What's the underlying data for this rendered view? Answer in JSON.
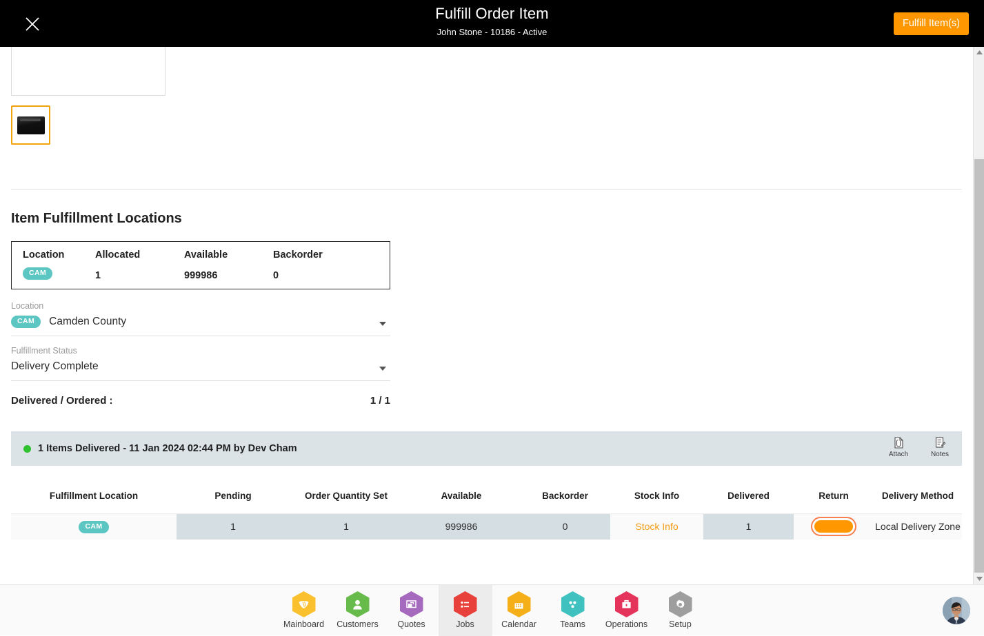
{
  "header": {
    "close_icon": "close-icon",
    "title": "Fulfill Order Item",
    "subtitle": "John Stone - 10186 - Active",
    "fulfill_button": "Fulfill Item(s)",
    "background": "#000000",
    "accent": "#ff9800"
  },
  "section": {
    "title": "Item Fulfillment Locations"
  },
  "location_card": {
    "headers": [
      "Location",
      "Allocated",
      "Available",
      "Backorder"
    ],
    "row": {
      "location_badge": "CAM",
      "allocated": "1",
      "available": "999986",
      "backorder": "0"
    }
  },
  "fields": {
    "location": {
      "label": "Location",
      "badge": "CAM",
      "value": "Camden County",
      "caret_icon": "chevron-down-icon"
    },
    "fulfillment_status": {
      "label": "Fulfillment Status",
      "value": "Delivery Complete",
      "caret_icon": "chevron-down-icon"
    }
  },
  "delivered_ordered": {
    "label": "Delivered / Ordered :",
    "value": "1 / 1"
  },
  "status_bar": {
    "dot_color": "#2fc22f",
    "text": "1 Items Delivered - 11 Jan 2024 02:44 PM by Dev Cham",
    "actions": [
      {
        "icon": "attach-icon",
        "label": "Attach"
      },
      {
        "icon": "notes-icon",
        "label": "Notes"
      }
    ]
  },
  "table": {
    "columns": [
      "Fulfillment Location",
      "Pending",
      "Order Quantity Set",
      "Available",
      "Backorder",
      "Stock Info",
      "Delivered",
      "Return",
      "Delivery Method"
    ],
    "rows": [
      {
        "fulfillment_location": "CAM",
        "pending": "1",
        "order_quantity_set": "1",
        "available": "999986",
        "backorder": "0",
        "stock_info": "Stock Info",
        "delivered": "1",
        "return": "",
        "delivery_method": "Local Delivery Zone"
      }
    ]
  },
  "scrollbar": {
    "up_icon": "caret-up-icon",
    "down_icon": "caret-down-icon"
  },
  "bottom_nav": {
    "items": [
      {
        "label": "Mainboard",
        "icon": "mainboard-icon",
        "color": "#fbc02d",
        "active": false
      },
      {
        "label": "Customers",
        "icon": "customers-icon",
        "color": "#66bb4a",
        "active": false
      },
      {
        "label": "Quotes",
        "icon": "quotes-icon",
        "color": "#a569bd",
        "active": false
      },
      {
        "label": "Jobs",
        "icon": "jobs-icon",
        "color": "#e8413c",
        "active": true
      },
      {
        "label": "Calendar",
        "icon": "calendar-icon",
        "color": "#f5af19",
        "active": false
      },
      {
        "label": "Teams",
        "icon": "teams-icon",
        "color": "#3fc1c0",
        "active": false
      },
      {
        "label": "Operations",
        "icon": "operations-icon",
        "color": "#e5345b",
        "active": false
      },
      {
        "label": "Setup",
        "icon": "setup-icon",
        "color": "#9e9e9e",
        "active": false
      }
    ],
    "avatar": "user-avatar"
  }
}
